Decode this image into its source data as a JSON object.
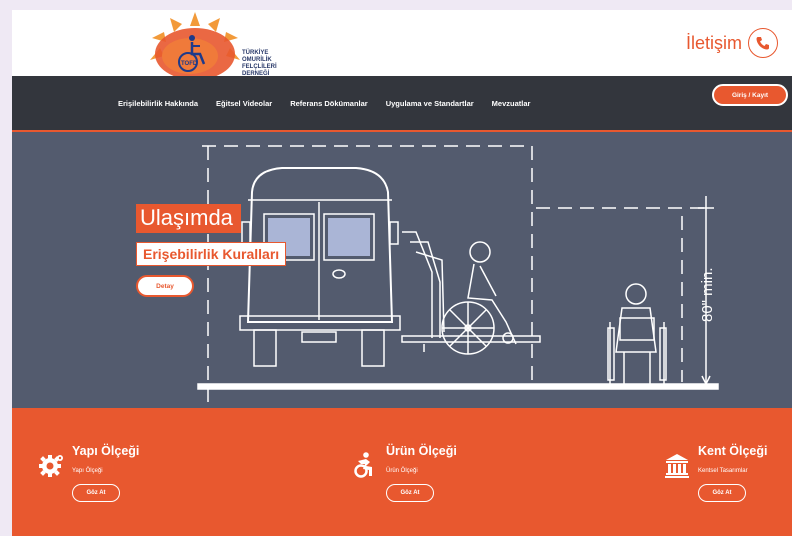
{
  "brand": {
    "logo_text_lines": [
      "TÜRKİYE",
      "OMURİLİK",
      "FELÇLİLERİ",
      "DERNEĞİ"
    ],
    "logo_badge": "TOFD"
  },
  "header": {
    "contact_label": "İletişim"
  },
  "nav": {
    "items": [
      {
        "label": "Erişilebilirlik Hakkında"
      },
      {
        "label": "Eğitsel Videolar"
      },
      {
        "label": "Referans Dökümanlar"
      },
      {
        "label": "Uygulama ve Standartlar"
      },
      {
        "label": "Mevzuatlar"
      }
    ],
    "login_label": "Giriş / Kayıt"
  },
  "hero": {
    "title": "Ulaşımda",
    "subtitle": "Erişebilirlik Kuralları",
    "button_label": "Detay",
    "dimension_label": "80\" min."
  },
  "cards": [
    {
      "title": "Yapı Ölçeği",
      "subtitle": "Yapı Ölçeği",
      "button_label": "Göz At",
      "icon": "gear-icon"
    },
    {
      "title": "Ürün Ölçeği",
      "subtitle": "Ürün Ölçeği",
      "button_label": "Göz At",
      "icon": "accessibility-icon"
    },
    {
      "title": "Kent Ölçeği",
      "subtitle": "Kentsel Tasarımlar",
      "button_label": "Göz At",
      "icon": "building-icon"
    }
  ],
  "colors": {
    "accent": "#e8582f",
    "nav_bg": "#33363d",
    "hero_bg": "#535b6e"
  }
}
